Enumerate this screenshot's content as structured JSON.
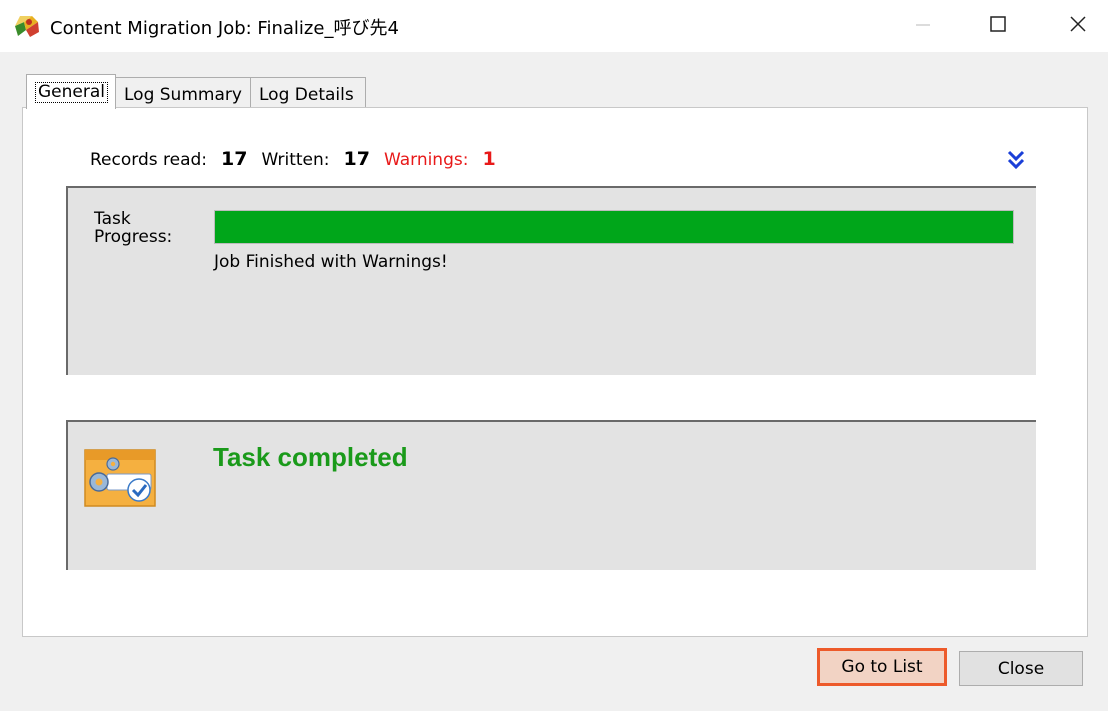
{
  "window": {
    "title": "Content Migration Job: Finalize_呼び先4",
    "app_icon": "migration-puzzle-icon",
    "minimize_icon": "minimize-icon",
    "maximize_icon": "maximize-icon",
    "close_icon": "close-icon"
  },
  "tabs": [
    {
      "label": "General",
      "active": true
    },
    {
      "label": "Log Summary",
      "active": false
    },
    {
      "label": "Log Details",
      "active": false
    }
  ],
  "stats": {
    "records_read_label": "Records read:",
    "records_read_value": "17",
    "written_label": "Written:",
    "written_value": "17",
    "warnings_label": "Warnings:",
    "warnings_value": "1",
    "expand_icon": "double-chevron-down-icon"
  },
  "progress": {
    "label": "Task Progress:",
    "percent": 100,
    "status_text": "Job Finished with Warnings!"
  },
  "completion": {
    "icon": "task-settings-check-icon",
    "message": "Task completed"
  },
  "buttons": {
    "go_to_list": "Go to List",
    "close": "Close"
  },
  "colors": {
    "progress_fill": "#00a61a",
    "completed_text": "#1a9a1a",
    "warning_text": "#e81919",
    "highlight_border": "#ed5a2a"
  }
}
